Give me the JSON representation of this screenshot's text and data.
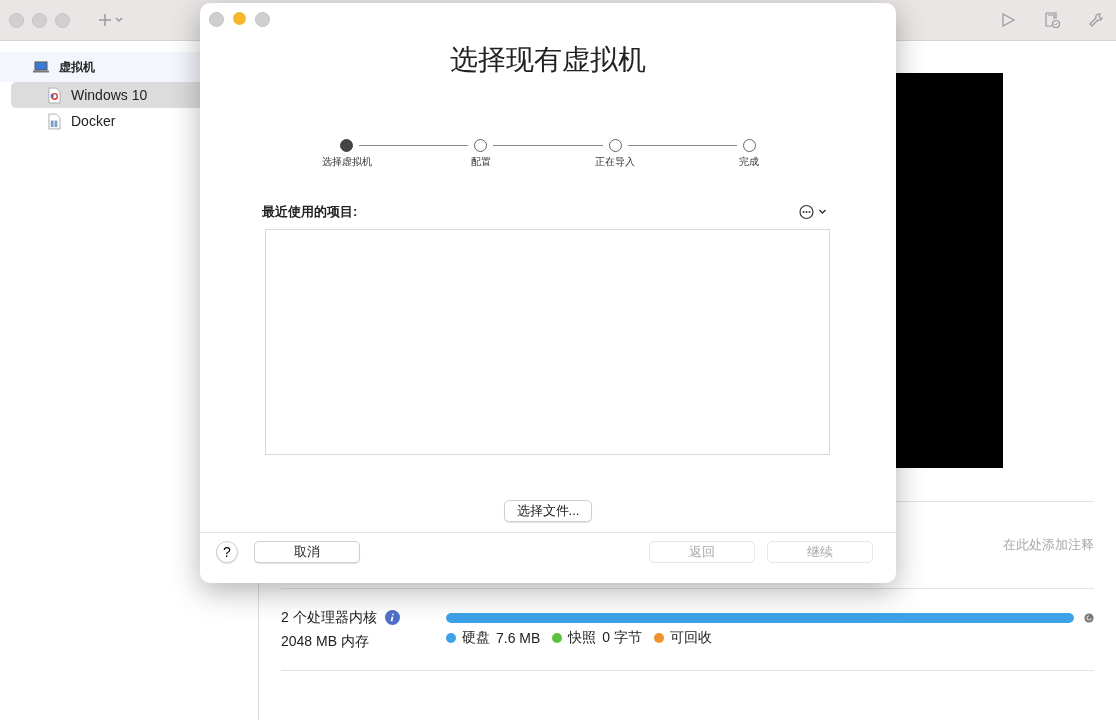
{
  "sidebar": {
    "group": {
      "label": "虚拟机"
    },
    "items": [
      {
        "label": "Windows 10",
        "selected": true
      },
      {
        "label": "Docker",
        "selected": false
      }
    ]
  },
  "details": {
    "note_placeholder": "在此处添加注释",
    "cpu": "2 个处理器内核",
    "memory": "2048 MB 内存",
    "disk_bar": {
      "level": 1
    },
    "legend": [
      {
        "label": "硬盘",
        "value": "7.6 MB",
        "color": "#3ea2e8"
      },
      {
        "label": "快照",
        "value": "0 字节",
        "color": "#5cc23a"
      },
      {
        "label": "可回收",
        "color": "#f0922e"
      }
    ]
  },
  "dialog": {
    "title": "选择现有虚拟机",
    "steps": [
      {
        "label": "选择虚拟机",
        "selected": true
      },
      {
        "label": "配置",
        "selected": false
      },
      {
        "label": "正在导入",
        "selected": false
      },
      {
        "label": "完成",
        "selected": false
      }
    ],
    "recent_label": "最近使用的项目:",
    "choose_file": "选择文件...",
    "help": "?",
    "buttons": [
      {
        "label": "取消",
        "disabled": false
      },
      {
        "label": "返回",
        "disabled": true
      },
      {
        "label": "继续",
        "disabled": true
      }
    ]
  }
}
